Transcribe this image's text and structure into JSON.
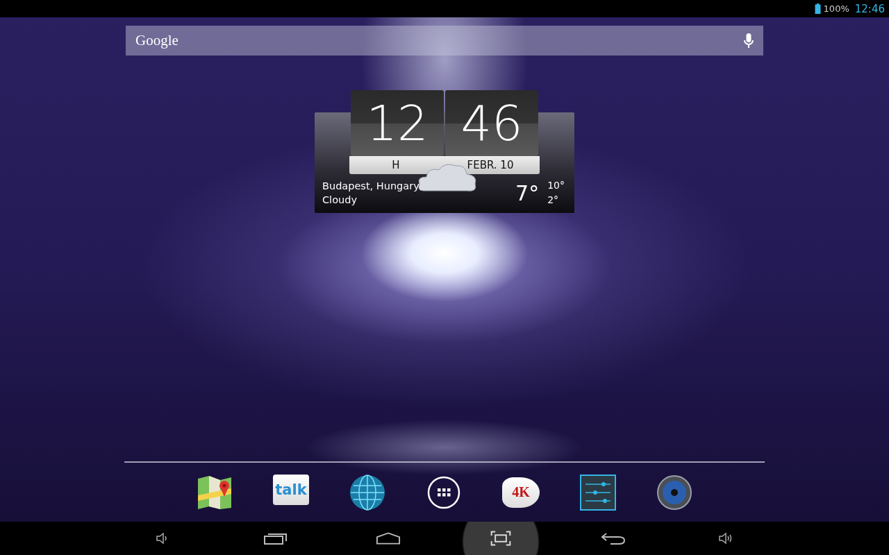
{
  "status_bar": {
    "battery": "100%",
    "time": "12:46"
  },
  "search": {
    "logo": "Google"
  },
  "clock_widget": {
    "hours": "12",
    "minutes": "46",
    "day": "H",
    "date": "FEBR. 10",
    "location": "Budapest, Hungary",
    "condition": "Cloudy",
    "temperature": "7°",
    "high": "10°",
    "low": "2°"
  },
  "dock": [
    {
      "kind": "maps"
    },
    {
      "kind": "talk",
      "label": "talk"
    },
    {
      "kind": "globe"
    },
    {
      "kind": "apps"
    },
    {
      "kind": "video",
      "label": "4K"
    },
    {
      "kind": "settings"
    },
    {
      "kind": "speaker"
    }
  ],
  "nav_bar": [
    {
      "kind": "volume-down"
    },
    {
      "kind": "recents"
    },
    {
      "kind": "home"
    },
    {
      "kind": "screenshot"
    },
    {
      "kind": "back"
    },
    {
      "kind": "volume-up"
    }
  ]
}
